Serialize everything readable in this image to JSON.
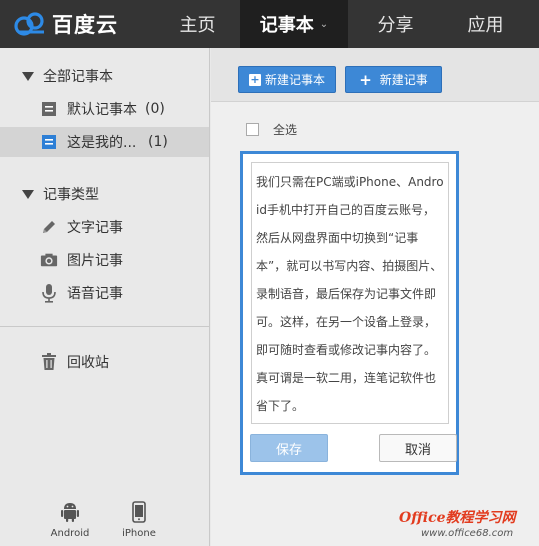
{
  "header": {
    "logo_text": "百度云",
    "nav": [
      {
        "label": "主页"
      },
      {
        "label": "记事本"
      },
      {
        "label": "分享"
      },
      {
        "label": "应用"
      }
    ],
    "active_caret": "⌄"
  },
  "sidebar": {
    "all_notebooks": "全部记事本",
    "notebooks": [
      {
        "label": "默认记事本",
        "count": "(0)"
      },
      {
        "label": "这是我的...",
        "count": "(1)"
      }
    ],
    "types_heading": "记事类型",
    "types": [
      {
        "label": "文字记事",
        "icon": "pencil-icon"
      },
      {
        "label": "图片记事",
        "icon": "camera-icon"
      },
      {
        "label": "语音记事",
        "icon": "microphone-icon"
      }
    ],
    "trash": "回收站",
    "devices": [
      {
        "label": "Android",
        "icon": "android-icon"
      },
      {
        "label": "iPhone",
        "icon": "iphone-icon"
      }
    ]
  },
  "toolbar": {
    "new_notebook": "新建记事本",
    "new_note": "新建记事",
    "select_all": "全选"
  },
  "note": {
    "content": "我们只需在PC端或iPhone、Android手机中打开自己的百度云账号，然后从网盘界面中切换到“记事本”，就可以书写内容、拍摄图片、录制语音，最后保存为记事文件即可。这样，在另一个设备上登录，即可随时查看或修改记事内容了。真可谓是一软二用，连笔记软件也省下了。",
    "save_label": "保存",
    "cancel_label": "取消"
  },
  "watermark": {
    "line1": "Office教程学习网",
    "line2": "www.office68.com"
  },
  "colors": {
    "topbar": "#343434",
    "accent": "#3d88d6",
    "watermark": "#e23b1e"
  }
}
